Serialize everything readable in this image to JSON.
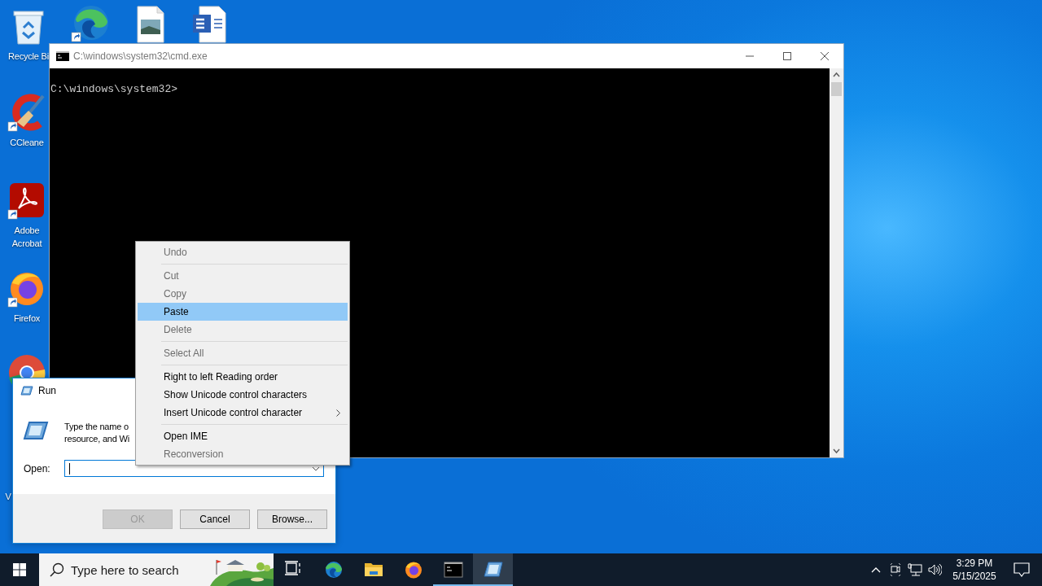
{
  "desktop": {
    "icons": [
      {
        "kind": "recycle_bin",
        "label": "Recycle Bi",
        "shortcut": false
      },
      {
        "kind": "edge",
        "shortcut": true
      },
      {
        "kind": "image_file",
        "shortcut": false
      },
      {
        "kind": "word_file",
        "shortcut": false
      },
      {
        "kind": "ccleaner",
        "label": "CCleane",
        "shortcut": true
      },
      {
        "kind": "acrobat",
        "label": "Adobe Acrobat",
        "shortcut": true
      },
      {
        "kind": "firefox",
        "label": "Firefox",
        "shortcut": true
      },
      {
        "kind": "chrome",
        "shortcut": false
      },
      {
        "kind": "covered",
        "label": "V"
      }
    ]
  },
  "cmd_window": {
    "title": "C:\\windows\\system32\\cmd.exe",
    "lines": [
      "C:\\windows\\system32>"
    ]
  },
  "run_dialog": {
    "title": "Run",
    "description_lines": [
      "Type the name o",
      "resource, and Wi"
    ],
    "open_label": "Open:",
    "buttons": [
      {
        "label": "OK",
        "disabled": true
      },
      {
        "label": "Cancel",
        "disabled": false
      },
      {
        "label": "Browse...",
        "disabled": false
      }
    ]
  },
  "context_menu": {
    "groups": [
      [
        {
          "label": "Undo",
          "disabled": true,
          "selected": false,
          "submenu": false
        }
      ],
      [
        {
          "label": "Cut",
          "disabled": true,
          "selected": false,
          "submenu": false
        },
        {
          "label": "Copy",
          "disabled": true,
          "selected": false,
          "submenu": false
        },
        {
          "label": "Paste",
          "disabled": false,
          "selected": true,
          "submenu": false
        },
        {
          "label": "Delete",
          "disabled": true,
          "selected": false,
          "submenu": false
        }
      ],
      [
        {
          "label": "Select All",
          "disabled": true,
          "selected": false,
          "submenu": false
        }
      ],
      [
        {
          "label": "Right to left Reading order",
          "disabled": false,
          "selected": false,
          "submenu": false
        },
        {
          "label": "Show Unicode control characters",
          "disabled": false,
          "selected": false,
          "submenu": false
        },
        {
          "label": "Insert Unicode control character",
          "disabled": false,
          "selected": false,
          "submenu": true
        }
      ],
      [
        {
          "label": "Open IME",
          "disabled": false,
          "selected": false,
          "submenu": false
        },
        {
          "label": "Reconversion",
          "disabled": true,
          "selected": false,
          "submenu": false
        }
      ]
    ]
  },
  "taskbar": {
    "search": {
      "placeholder": "Type here to search"
    },
    "buttons": [
      {
        "kind": "task_view",
        "running": false,
        "selected": false
      },
      {
        "kind": "edge",
        "running": false,
        "selected": false
      },
      {
        "kind": "explorer",
        "running": false,
        "selected": false
      },
      {
        "kind": "firefox",
        "running": false,
        "selected": false
      },
      {
        "kind": "cmd",
        "running": true,
        "selected": false
      },
      {
        "kind": "run",
        "running": true,
        "selected": true
      }
    ],
    "tray": {
      "time": "3:29 PM",
      "date": "5/15/2025"
    }
  }
}
